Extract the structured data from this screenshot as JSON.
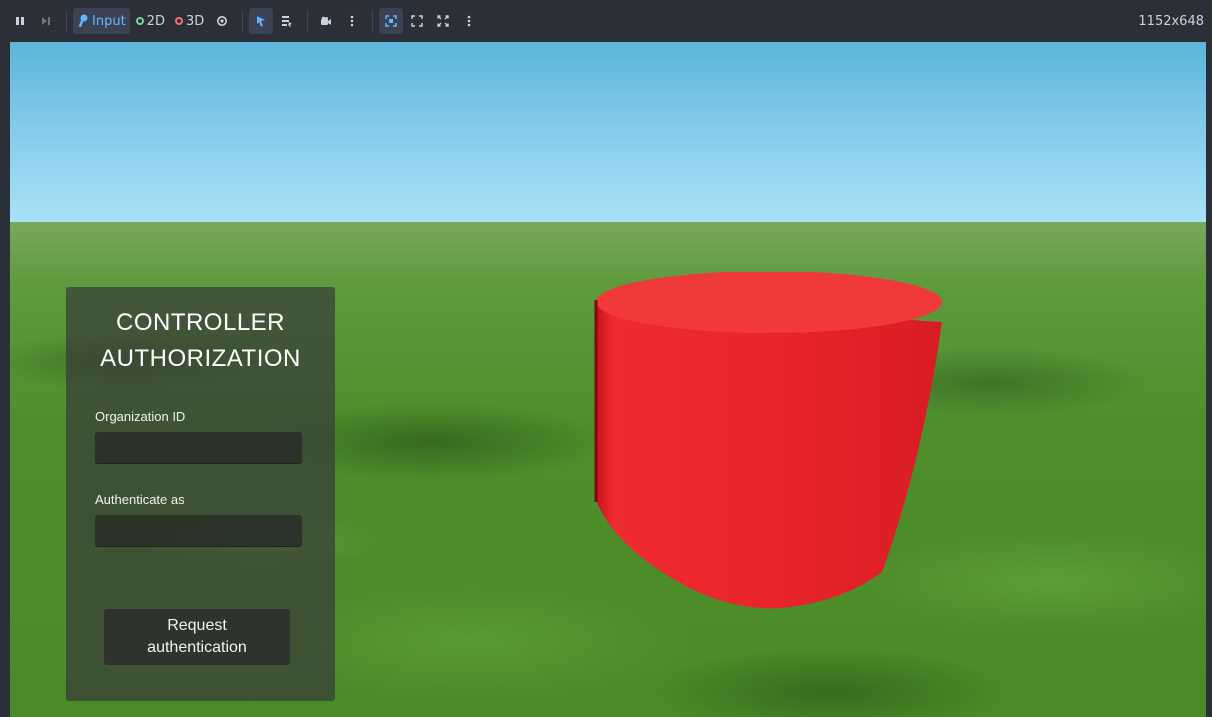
{
  "toolbar": {
    "pause_icon": "pause-icon",
    "step_icon": "next-frame-icon",
    "input_label": "Input",
    "mode_2d_label": "2D",
    "mode_3d_label": "3D",
    "resolution": "1152x648"
  },
  "panel": {
    "title_line1": "CONTROLLER",
    "title_line2": "AUTHORIZATION",
    "org_label": "Organization ID",
    "org_value": "",
    "auth_as_label": "Authenticate as",
    "auth_as_value": "",
    "button_label": "Request\nauthentication"
  },
  "colors": {
    "toolbar_bg": "#2b2f38",
    "input_accent": "#62b5ff",
    "cylinder": "#e8202a"
  }
}
